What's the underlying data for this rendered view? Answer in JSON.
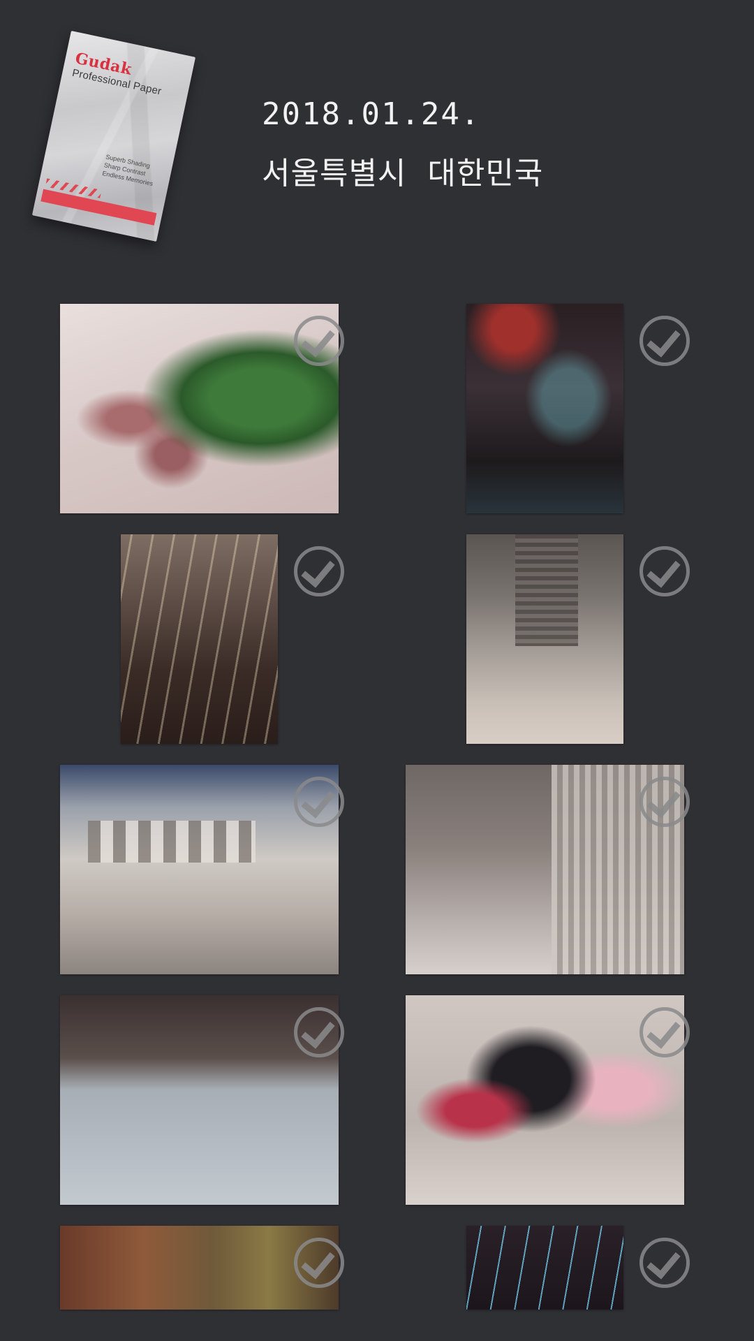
{
  "header": {
    "date": "2018.01.24.",
    "location": "서울특별시  대한민국",
    "paper_pack": {
      "brand": "Gudak",
      "subtitle": "Professional Paper",
      "fine_print": [
        "Superb Shading",
        "Sharp Contrast",
        "Endless Memories"
      ]
    }
  },
  "photos": [
    {
      "id": "photo-1",
      "description_icon": "check-circle-icon"
    },
    {
      "id": "photo-2",
      "description_icon": "check-circle-icon"
    },
    {
      "id": "photo-3",
      "description_icon": "check-circle-icon"
    },
    {
      "id": "photo-4",
      "description_icon": "check-circle-icon"
    },
    {
      "id": "photo-5",
      "description_icon": "check-circle-icon"
    },
    {
      "id": "photo-6",
      "description_icon": "check-circle-icon"
    },
    {
      "id": "photo-7",
      "description_icon": "check-circle-icon"
    },
    {
      "id": "photo-8",
      "description_icon": "check-circle-icon"
    },
    {
      "id": "photo-9",
      "description_icon": "check-circle-icon"
    },
    {
      "id": "photo-10",
      "description_icon": "check-circle-icon"
    }
  ],
  "colors": {
    "background": "#2f3034",
    "text": "#f2f2f2",
    "check": "#8a8a8c",
    "accent": "#e14653"
  }
}
